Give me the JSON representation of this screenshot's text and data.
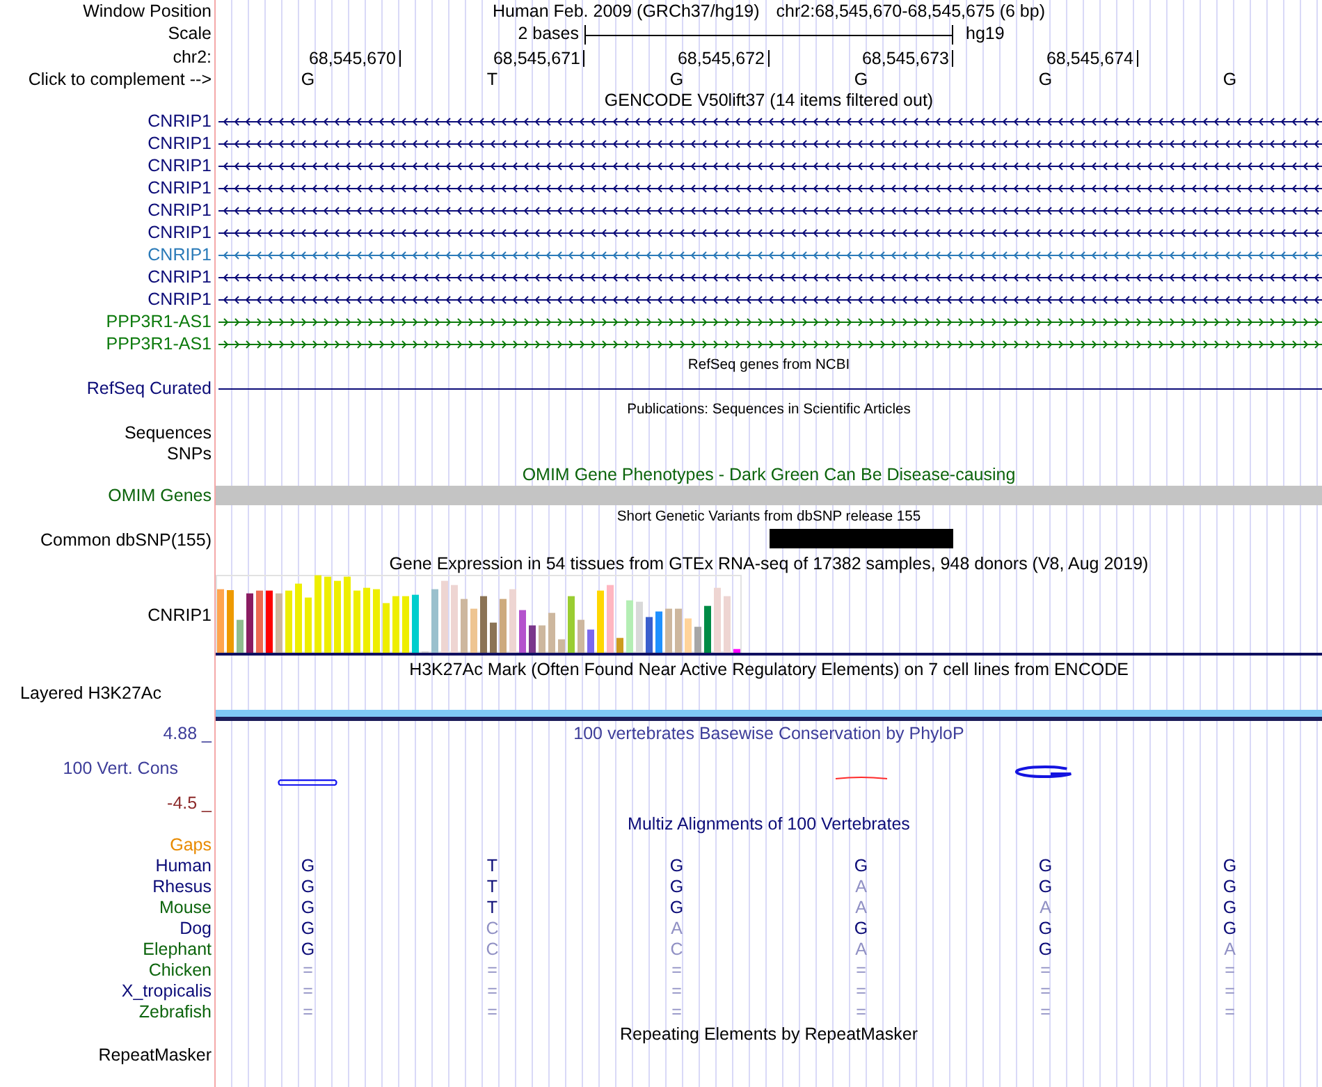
{
  "header": {
    "position": {
      "label": "Window Position",
      "assembly": "Human Feb. 2009 (GRCh37/hg19)",
      "range": "chr2:68,545,670-68,545,675 (6 bp)"
    },
    "scale": {
      "label": "Scale",
      "span": "2 bases",
      "assembly": "hg19"
    },
    "ruler": {
      "label": "chr2:",
      "ticks": [
        "68,545,670",
        "68,545,671",
        "68,545,672",
        "68,545,673",
        "68,545,674"
      ]
    },
    "sequence": {
      "label": "Click to complement -->",
      "bases": [
        "G",
        "T",
        "G",
        "G",
        "G",
        "G"
      ]
    }
  },
  "tracks": [
    {
      "kind": "genes",
      "title": {
        "text": "GENCODE V50lift37 (14 items filtered out)",
        "color": "#000000"
      },
      "items": [
        {
          "name": "CNRIP1",
          "reverse": true,
          "color": "#0c0c78"
        },
        {
          "name": "CNRIP1",
          "reverse": true,
          "color": "#0c0c78"
        },
        {
          "name": "CNRIP1",
          "reverse": true,
          "color": "#0c0c78"
        },
        {
          "name": "CNRIP1",
          "reverse": true,
          "color": "#0c0c78"
        },
        {
          "name": "CNRIP1",
          "reverse": true,
          "color": "#0c0c78"
        },
        {
          "name": "CNRIP1",
          "reverse": true,
          "color": "#0c0c78"
        },
        {
          "name": "CNRIP1",
          "reverse": true,
          "color": "#2a7ab8"
        },
        {
          "name": "CNRIP1",
          "reverse": true,
          "color": "#0c0c78"
        },
        {
          "name": "CNRIP1",
          "reverse": true,
          "color": "#0c0c78"
        },
        {
          "name": "PPP3R1-AS1",
          "reverse": false,
          "color": "#0c7a0c"
        },
        {
          "name": "PPP3R1-AS1",
          "reverse": false,
          "color": "#0c7a0c"
        }
      ]
    },
    {
      "kind": "line",
      "title": {
        "text": "RefSeq genes from NCBI",
        "color": "#000000"
      },
      "label": "RefSeq Curated",
      "color": "#0c0c78"
    },
    {
      "kind": "labels",
      "title": {
        "text": "Publications: Sequences in Scientific Articles",
        "color": "#000000"
      },
      "labels": [
        "Sequences",
        "SNPs"
      ],
      "color": "#000000"
    },
    {
      "kind": "bar",
      "title": {
        "text": "OMIM Gene Phenotypes - Dark Green Can Be Disease-causing",
        "color": "#0c640c"
      },
      "label": "OMIM Genes",
      "color": "#0c640c"
    },
    {
      "kind": "variants",
      "title": {
        "text": "Short Genetic Variants from dbSNP release 155",
        "color": "#000000"
      },
      "label": "Common dbSNP(155)",
      "color": "#000000",
      "variants": [
        {
          "present": false
        },
        {
          "present": false
        },
        {
          "present": false
        },
        {
          "present": true
        },
        {
          "present": false
        },
        {
          "present": false
        }
      ]
    },
    {
      "kind": "expression",
      "title": {
        "text": "Gene Expression in 54 tissues from GTEx RNA-seq of 17382 samples, 948 donors (V8, Aug 2019)",
        "color": "#000000"
      },
      "label": "CNRIP1",
      "color": "#000000"
    },
    {
      "kind": "signal",
      "title": {
        "text": "H3K27Ac Mark (Often Found Near Active Regulatory Elements) on 7 cell lines from ENCODE",
        "color": "#000000"
      },
      "label": "Layered H3K27Ac",
      "color": "#000000"
    },
    {
      "kind": "conservation",
      "title": {
        "text": "100 vertebrates Basewise Conservation by PhyloP",
        "color": "#3d3d99"
      },
      "label": "100 Vert. Cons",
      "color": "#3d3d99",
      "max_label": "4.88 _",
      "min_label": "-4.5 _"
    },
    {
      "kind": "alignment",
      "title": {
        "text": "Multiz Alignments of 100 Vertebrates",
        "color": "#0c0c78"
      },
      "gaps": {
        "label": "Gaps",
        "color": "#e88a00"
      },
      "species": [
        {
          "name": "Human",
          "color": "#0c0c78",
          "bases": [
            {
              "base": "G",
              "match": true
            },
            {
              "base": "T",
              "match": true
            },
            {
              "base": "G",
              "match": true
            },
            {
              "base": "G",
              "match": true
            },
            {
              "base": "G",
              "match": true
            },
            {
              "base": "G",
              "match": true
            }
          ]
        },
        {
          "name": "Rhesus",
          "color": "#0c0c78",
          "bases": [
            {
              "base": "G",
              "match": true
            },
            {
              "base": "T",
              "match": true
            },
            {
              "base": "G",
              "match": true
            },
            {
              "base": "A",
              "match": false
            },
            {
              "base": "G",
              "match": true
            },
            {
              "base": "G",
              "match": true
            }
          ]
        },
        {
          "name": "Mouse",
          "color": "#0c640c",
          "bases": [
            {
              "base": "G",
              "match": true
            },
            {
              "base": "T",
              "match": true
            },
            {
              "base": "G",
              "match": true
            },
            {
              "base": "A",
              "match": false
            },
            {
              "base": "A",
              "match": false
            },
            {
              "base": "G",
              "match": true
            }
          ]
        },
        {
          "name": "Dog",
          "color": "#0c0c78",
          "bases": [
            {
              "base": "G",
              "match": true
            },
            {
              "base": "C",
              "match": false
            },
            {
              "base": "A",
              "match": false
            },
            {
              "base": "G",
              "match": true
            },
            {
              "base": "G",
              "match": true
            },
            {
              "base": "G",
              "match": true
            }
          ]
        },
        {
          "name": "Elephant",
          "color": "#0c640c",
          "bases": [
            {
              "base": "G",
              "match": true
            },
            {
              "base": "C",
              "match": false
            },
            {
              "base": "C",
              "match": false
            },
            {
              "base": "A",
              "match": false
            },
            {
              "base": "G",
              "match": true
            },
            {
              "base": "A",
              "match": false
            }
          ]
        },
        {
          "name": "Chicken",
          "color": "#0c640c",
          "bases": [
            {
              "base": "=",
              "match": false
            },
            {
              "base": "=",
              "match": false
            },
            {
              "base": "=",
              "match": false
            },
            {
              "base": "=",
              "match": false
            },
            {
              "base": "=",
              "match": false
            },
            {
              "base": "=",
              "match": false
            }
          ]
        },
        {
          "name": "X_tropicalis",
          "color": "#0c0c78",
          "bases": [
            {
              "base": "=",
              "match": false
            },
            {
              "base": "=",
              "match": false
            },
            {
              "base": "=",
              "match": false
            },
            {
              "base": "=",
              "match": false
            },
            {
              "base": "=",
              "match": false
            },
            {
              "base": "=",
              "match": false
            }
          ]
        },
        {
          "name": "Zebrafish",
          "color": "#0c640c",
          "bases": [
            {
              "base": "=",
              "match": false
            },
            {
              "base": "=",
              "match": false
            },
            {
              "base": "=",
              "match": false
            },
            {
              "base": "=",
              "match": false
            },
            {
              "base": "=",
              "match": false
            },
            {
              "base": "=",
              "match": false
            }
          ]
        }
      ]
    },
    {
      "kind": "repeats",
      "title": {
        "text": "Repeating Elements by RepeatMasker",
        "color": "#000000"
      },
      "label": "RepeatMasker",
      "color": "#000000"
    }
  ]
}
